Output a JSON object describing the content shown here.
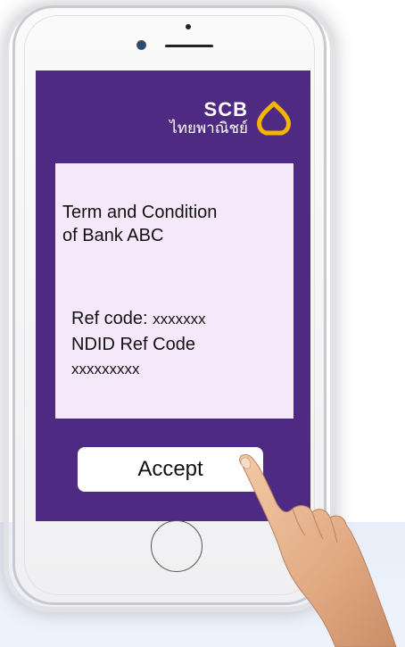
{
  "bank": {
    "brand": "SCB",
    "thai_name": "ไทยพาณิชย์",
    "logo_color": "#f4b400",
    "theme_color": "#4f2a82"
  },
  "terms": {
    "title_line1": "Term and Condition",
    "title_line2": "of Bank ABC",
    "ref_label": "Ref code:",
    "ref_value": "xxxxxxx",
    "ndid_label": "NDID Ref Code",
    "ndid_value": "xxxxxxxxx"
  },
  "actions": {
    "accept_label": "Accept"
  },
  "icons": {
    "logo": "scb-lotus-icon",
    "hand": "pointing-hand-icon",
    "home": "home-button-icon"
  }
}
